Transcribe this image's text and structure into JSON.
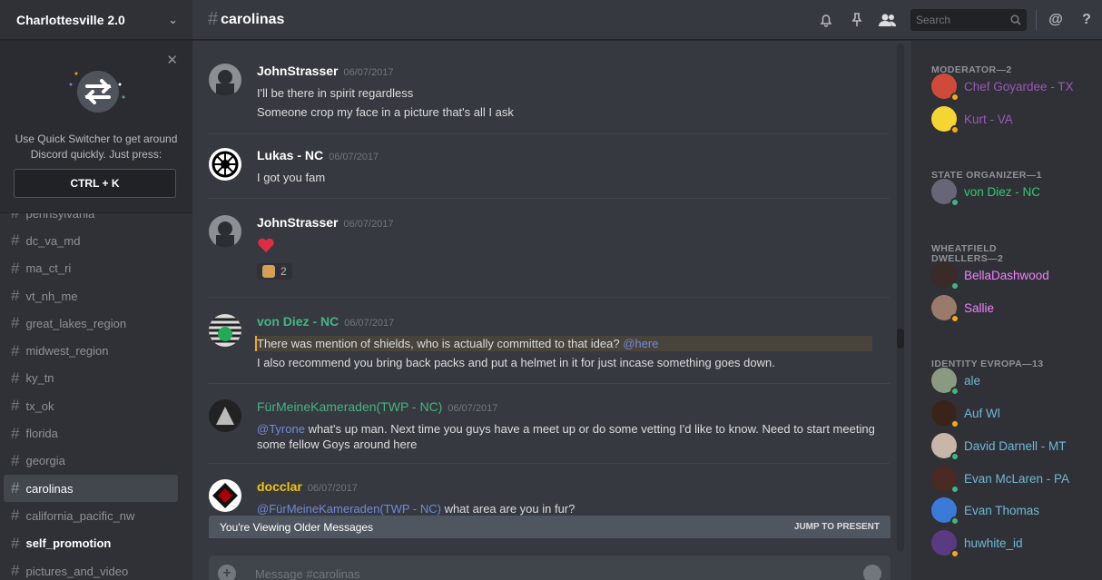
{
  "server": {
    "name": "Charlottesville 2.0"
  },
  "quick_switcher": {
    "text": "Use Quick Switcher to get around Discord quickly. Just press:",
    "shortcut": "CTRL + K"
  },
  "channels": [
    {
      "name": "pennsylvania",
      "state": "muted"
    },
    {
      "name": "dc_va_md",
      "state": "normal"
    },
    {
      "name": "ma_ct_ri",
      "state": "normal"
    },
    {
      "name": "vt_nh_me",
      "state": "normal"
    },
    {
      "name": "great_lakes_region",
      "state": "normal"
    },
    {
      "name": "midwest_region",
      "state": "normal"
    },
    {
      "name": "ky_tn",
      "state": "normal"
    },
    {
      "name": "tx_ok",
      "state": "normal"
    },
    {
      "name": "florida",
      "state": "normal"
    },
    {
      "name": "georgia",
      "state": "normal"
    },
    {
      "name": "carolinas",
      "state": "active"
    },
    {
      "name": "california_pacific_nw",
      "state": "normal"
    },
    {
      "name": "self_promotion",
      "state": "unread"
    },
    {
      "name": "pictures_and_video",
      "state": "normal"
    }
  ],
  "header": {
    "channel": "carolinas",
    "search_placeholder": "Search"
  },
  "messages": [
    {
      "author": "JohnStrasser",
      "color": "#ffffff",
      "time": "06/07/2017",
      "lines": [
        "I'll be there in spirit regardless",
        "Someone crop my face in a picture that's all I ask"
      ]
    },
    {
      "author": "Lukas - NC",
      "color": "#ffffff",
      "time": "06/07/2017",
      "lines": [
        "I got you fam"
      ]
    },
    {
      "author": "JohnStrasser",
      "color": "#ffffff",
      "time": "06/07/2017",
      "lines": [],
      "reaction_count": "2"
    },
    {
      "author": "von Diez - NC",
      "color": "#43b581",
      "time": "06/07/2017",
      "line1": "There was mention of shields, who is actually committed to that idea?",
      "line1_mention": "@here",
      "line2": "I also recommend you bring back packs and put a helmet in it for just incase something goes down."
    },
    {
      "author": "FürMeineKameraden(TWP - NC)",
      "color": "#43b581",
      "time": "06/07/2017",
      "mention": "@Tyrone",
      "text": " what's up man. Next time you guys have a meet up or do some vetting I'd like to know. Need to start meeting some fellow Goys around here"
    },
    {
      "author": "docclar",
      "color": "#f1c40f",
      "time": "06/07/2017",
      "mention": "@FürMeineKameraden(TWP - NC)",
      "text": " what area are you in fur?"
    }
  ],
  "older_bar": {
    "text": "You're Viewing Older Messages",
    "jump": "JUMP TO PRESENT"
  },
  "composer": {
    "placeholder": "Message #carolinas"
  },
  "member_groups": [
    {
      "title": "MODERATOR—2",
      "members": [
        {
          "name": "Chef Goyardee - TX",
          "color": "#9b59b6",
          "status": "#faa61a"
        },
        {
          "name": "Kurt - VA",
          "color": "#9b59b6",
          "status": "#faa61a"
        }
      ]
    },
    {
      "title": "STATE ORGANIZER—1",
      "members": [
        {
          "name": "von Diez - NC",
          "color": "#2ecc71",
          "status": "#43b581"
        }
      ]
    },
    {
      "title": "WHEATFIELD DWELLERS—2",
      "members": [
        {
          "name": "BellaDashwood",
          "color": "#f47fff",
          "status": "#43b581"
        },
        {
          "name": "Sallie",
          "color": "#f47fff",
          "status": "#faa61a"
        }
      ]
    },
    {
      "title": "IDENTITY EVROPA—13",
      "members": [
        {
          "name": "ale",
          "color": "#6fb8d6",
          "status": "#43b581"
        },
        {
          "name": "Auf Wl",
          "color": "#6fb8d6",
          "status": "#faa61a"
        },
        {
          "name": "David Darnell - MT",
          "color": "#6fb8d6",
          "status": "#43b581"
        },
        {
          "name": "Evan McLaren - PA",
          "color": "#6fb8d6",
          "status": "#43b581"
        },
        {
          "name": "Evan Thomas",
          "color": "#6fb8d6",
          "status": "#43b581"
        },
        {
          "name": "huwhite_id",
          "color": "#6fb8d6",
          "status": "#faa61a"
        }
      ]
    }
  ]
}
